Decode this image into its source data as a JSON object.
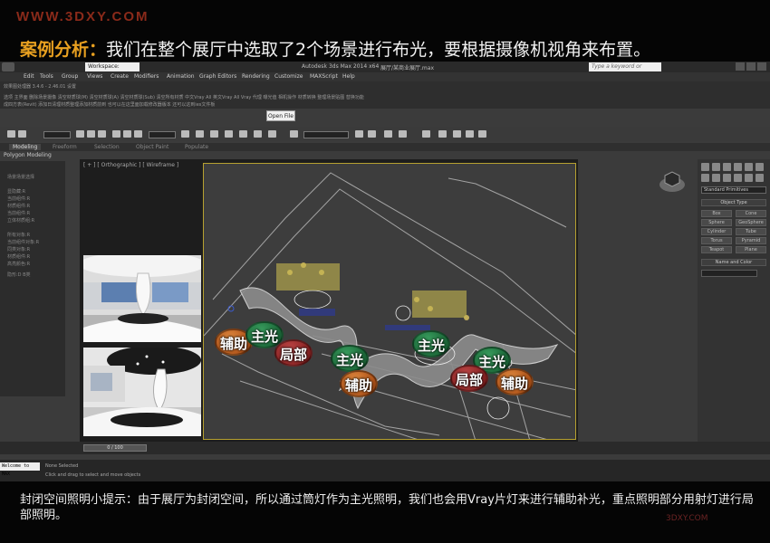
{
  "watermark_top": "WWW.3DXY.COM",
  "headline": {
    "highlight": "案例分析：",
    "text": "我们在整个展厅中选取了2个场景进行布光，要根据摄像机视角来布置。"
  },
  "app": {
    "workspace": "Workspace: Default",
    "title": "Autodesk 3ds Max  2014 x64",
    "file": "展厅/某商业展厅.max",
    "search_placeholder": "Type a keyword or phrase",
    "menu": [
      "Edit",
      "Tools",
      "Group",
      "Views",
      "Create",
      "Modifiers",
      "Animation",
      "Graph Editors",
      "Rendering",
      "Customize",
      "MAXScript",
      "Help"
    ],
    "plugin_rows": [
      "效果图处理器 3.4.6 - 2.46.01     设置",
      "选项   主界面   删除场景摄像   清空材质球(M)   清空材质球(A)   清空材质球(Sub)   清空所有材质   中文Vray All   英文Vray All   Vray 代理   曝光值   相机操作   材质转换   整理场景贴图   替换功能",
      "成四方表(Revit)   添加日清理材质整理添加材质前到   也可以在这里面加载修改器版本   还可以这到ies文件板"
    ],
    "open_file": "Open File",
    "tabs": [
      "Modeling",
      "Freeform",
      "Selection",
      "Object Paint",
      "Populate"
    ],
    "poly_modeling": "Polygon Modeling",
    "left_items": [
      "场景场景选择",
      "显隐藏:R",
      "当前组件:R",
      "材质组件:R",
      "当前组件:R",
      "立体材质组:R",
      "所有对象:R",
      "当前组件对象:R",
      "同类对象:R",
      "材质组件:R",
      "高亮颜色:R",
      "隐形:D B类"
    ],
    "viewport_label": "[ + ] [ Orthographic ] [ Wireframe ]",
    "right_panel": {
      "category": "Standard Primitives",
      "object_type": "Object Type",
      "buttons": [
        "Box",
        "Cone",
        "Sphere",
        "GeoSphere",
        "Cylinder",
        "Tube",
        "Torus",
        "Pyramid",
        "Teapot",
        "Plane"
      ],
      "name_color": "Name and Color"
    },
    "time_slider": "0 / 100",
    "welcome": "Welcome to MAX",
    "status_1": "None Selected",
    "status_2": "Click and drag to select and move objects"
  },
  "lights": {
    "main": "主光",
    "fill": "辅助",
    "local": "局部"
  },
  "colors": {
    "main_light": "#1d6a3a",
    "fill_light": "#b0541a",
    "local_light": "#8a2424",
    "accent": "#e8a020"
  },
  "tip": "封闭空间照明小提示：由于展厅为封闭空间，所以通过筒灯作为主光照明，我们也会用Vray片灯来进行辅助补光，重点照明部分用射灯进行局部照明。",
  "brand_watermark": "3DXY.COM"
}
